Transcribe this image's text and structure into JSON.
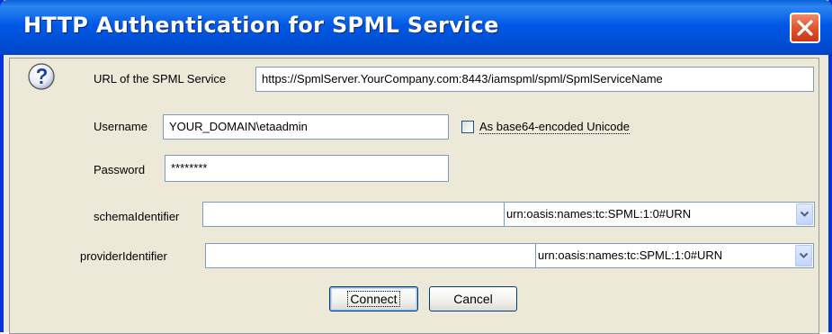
{
  "window": {
    "title": "HTTP Authentication for SPML Service"
  },
  "form": {
    "url_label": "URL of the SPML Service",
    "url_value": "https://SpmlServer.YourCompany.com:8443/iamspml/spml/SpmlServiceName",
    "username_label": "Username",
    "username_value": "YOUR_DOMAIN\\etaadmin",
    "base64_label": "As base64-encoded Unicode",
    "base64_checked": false,
    "password_label": "Password",
    "password_value": "********",
    "schema_label": "schemaIdentifier",
    "schema_value": "",
    "schema_type": "urn:oasis:names:tc:SPML:1:0#URN",
    "provider_label": "providerIdentifier",
    "provider_value": "",
    "provider_type": "urn:oasis:names:tc:SPML:1:0#URN"
  },
  "buttons": {
    "connect": "Connect",
    "cancel": "Cancel"
  },
  "colors": {
    "titlebar": "#0058e6",
    "close": "#e05530",
    "dialog_bg": "#ece9d8",
    "field_border": "#7f9db9"
  },
  "icons": {
    "close": "close-icon",
    "question": "question-icon",
    "dropdown": "chevron-down-icon"
  }
}
